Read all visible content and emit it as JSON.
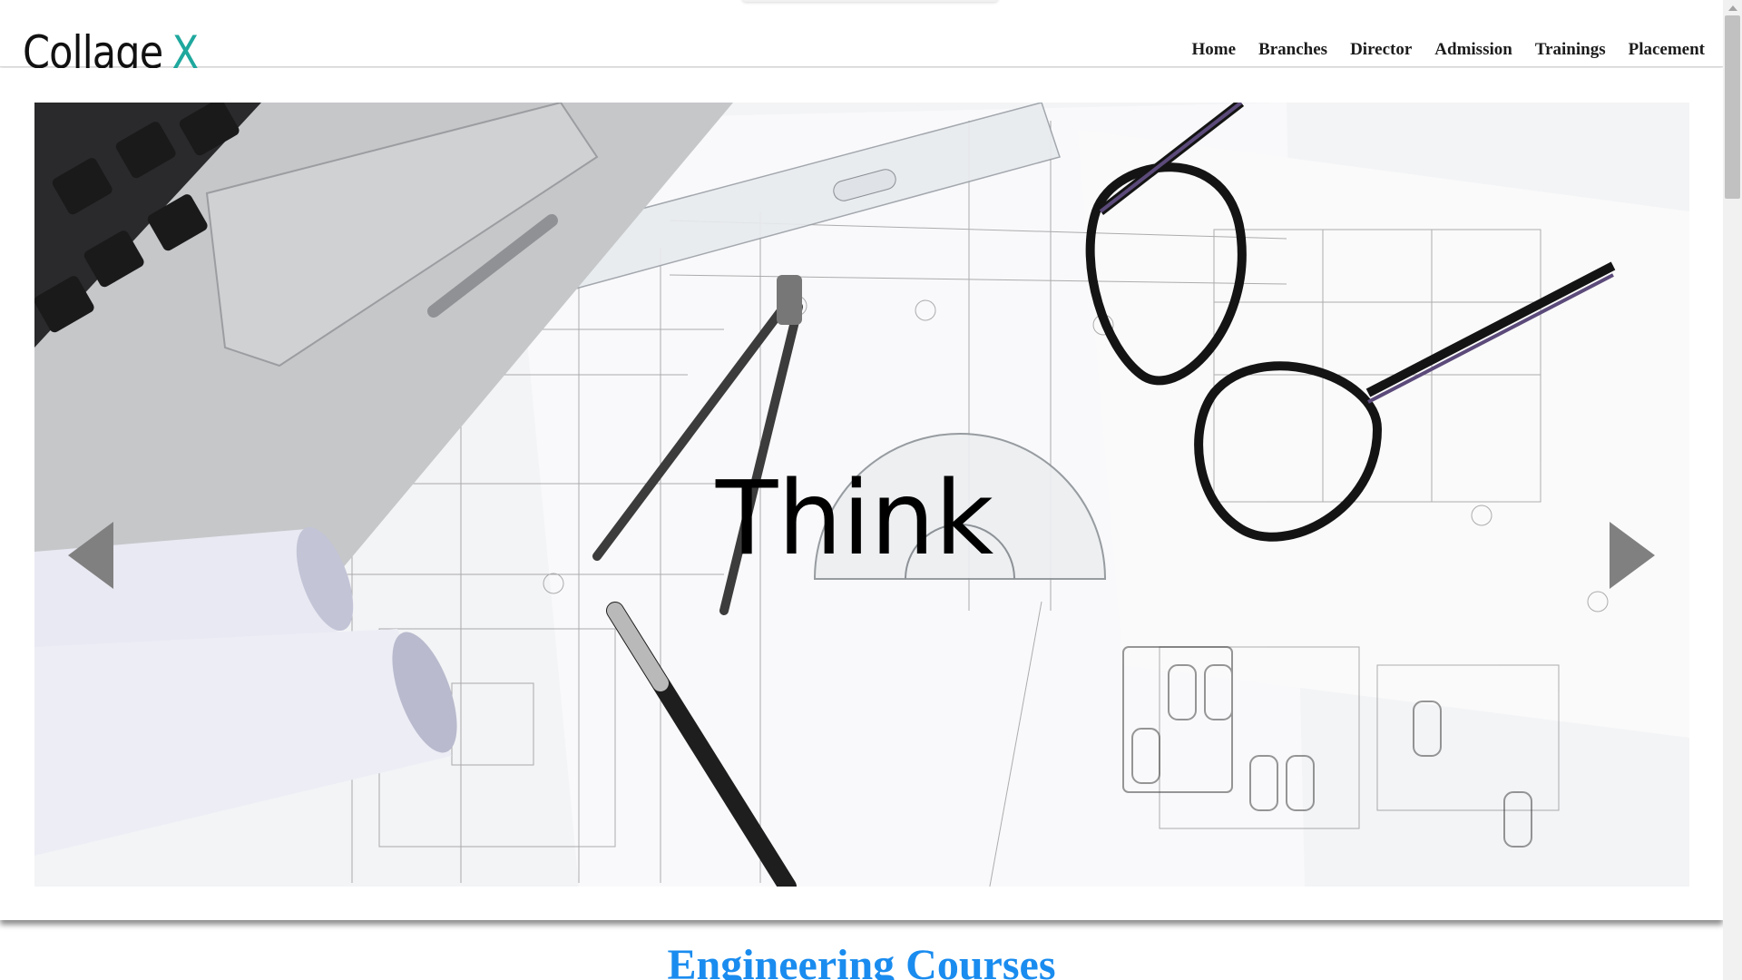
{
  "header": {
    "logo_text": "Collage",
    "logo_accent": "X",
    "nav": [
      "Home",
      "Branches",
      "Director",
      "Admission",
      "Trainings",
      "Placement"
    ]
  },
  "slider": {
    "caption": "Think",
    "prev_icon": "triangle-left-icon",
    "next_icon": "triangle-right-icon"
  },
  "section": {
    "title": "Engineering Courses"
  },
  "colors": {
    "accent": "#1fa89e",
    "section_title": "#1a8cef",
    "arrow": "#808080"
  }
}
